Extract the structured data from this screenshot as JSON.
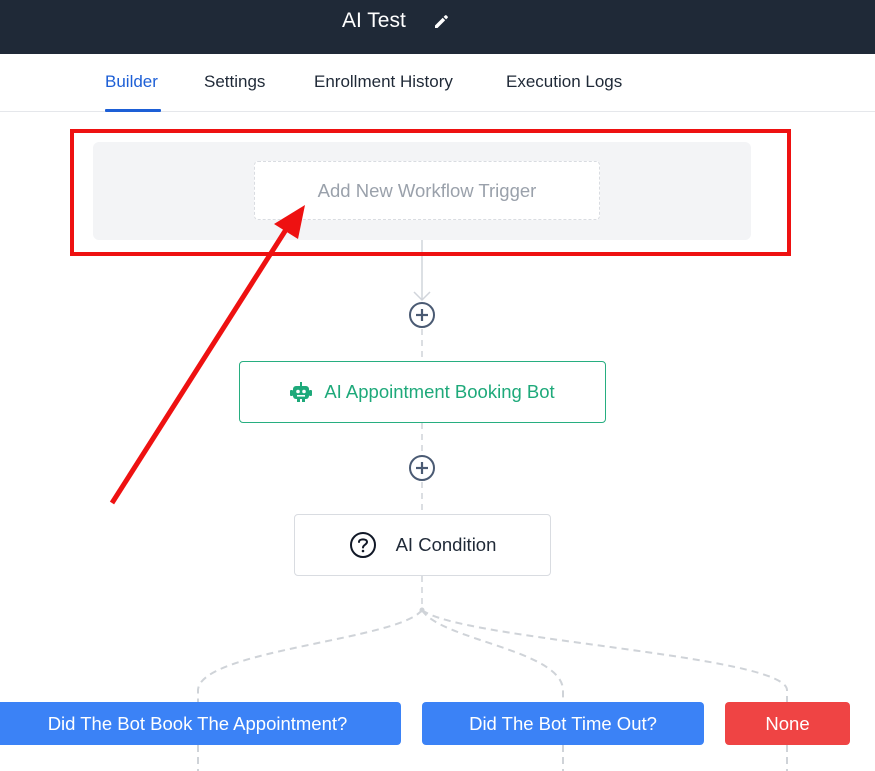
{
  "header": {
    "title": "AI Test",
    "edit_icon": "pencil-icon"
  },
  "tabs": [
    {
      "label": "Builder",
      "active": true
    },
    {
      "label": "Settings",
      "active": false
    },
    {
      "label": "Enrollment History",
      "active": false
    },
    {
      "label": "Execution Logs",
      "active": false
    }
  ],
  "workflow": {
    "trigger_placeholder": "Add New Workflow Trigger",
    "nodes": [
      {
        "label": "AI Appointment Booking Bot",
        "icon": "robot-icon",
        "color": "#1ea97a"
      },
      {
        "label": "AI Condition",
        "icon": "question-circle-icon"
      }
    ],
    "add_step_icon": "plus-circle-icon",
    "branches": [
      {
        "label": "Did The Bot Book The Appointment?",
        "color": "#3b82f6"
      },
      {
        "label": "Did The Bot Time Out?",
        "color": "#3b82f6"
      },
      {
        "label": "None",
        "color": "#ef4444"
      }
    ]
  },
  "annotation": {
    "highlight_color": "#ee1111",
    "arrow_color": "#ee1111"
  },
  "colors": {
    "header_bg": "#1f2937",
    "accent": "#1d5fd6"
  }
}
